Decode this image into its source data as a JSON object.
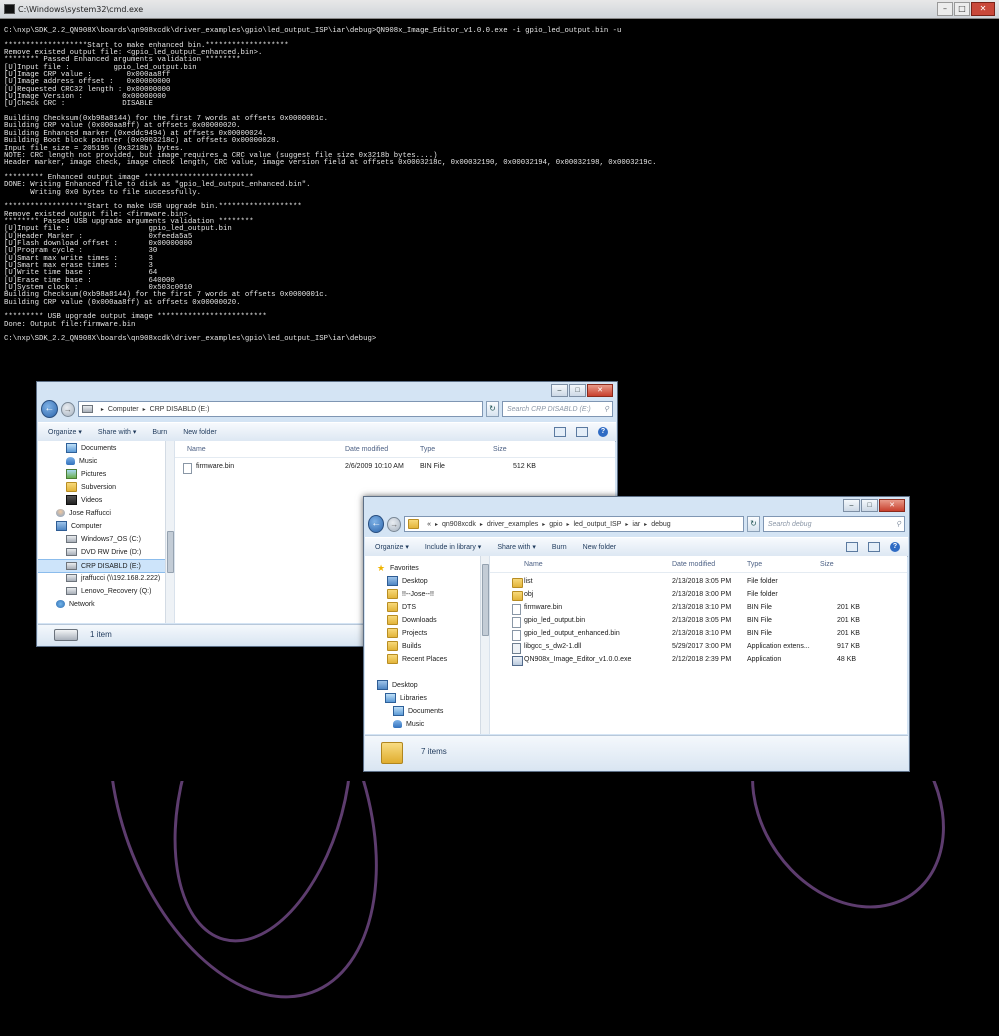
{
  "cmd": {
    "title": "C:\\Windows\\system32\\cmd.exe",
    "lines": [
      "C:\\nxp\\SDK_2.2_QN908X\\boards\\qn908xcdk\\driver_examples\\gpio\\led_output_ISP\\iar\\debug>QN908x_Image_Editor_v1.0.0.exe -i gpio_led_output.bin -u",
      "",
      "*******************Start to make enhanced bin.*******************",
      "Remove existed output file: <gpio_led_output_enhanced.bin>.",
      "******** Passed Enhanced arguments validation ********",
      "[U]Input file :          gpio_led_output.bin",
      "[U]Image CRP value :        0x000aa8ff",
      "[U]Image address offset :   0x00000000",
      "[U]Requested CRC32 length : 0x00000000",
      "[U]Image Version :         0x00000000",
      "[U]Check CRC :             DISABLE",
      "",
      "Building Checksum(0xb98a8144) for the first 7 words at offsets 0x0000001c.",
      "Building CRP value (0x000aa8ff) at offsets 0x00000020.",
      "Building Enhanced marker (0xeddc9494) at offsets 0x00000024.",
      "Building Boot block pointer (0x0003218c) at offsets 0x00000028.",
      "Input file size = 205195 (0x3218b) bytes.",
      "NOTE: CRC length not provided, but image requires a CRC value (suggest file size 0x3218b bytes....)",
      "Header marker, image check, image check length, CRC value, image version field at offsets 0x0003218c, 0x00032190, 0x00032194, 0x00032198, 0x0003219c.",
      "",
      "********* Enhanced output image *************************",
      "DONE: Writing Enhanced file to disk as \"gpio_led_output_enhanced.bin\".",
      "      Writing 0x0 bytes to file successfully.",
      "",
      "*******************Start to make USB upgrade bin.*******************",
      "Remove existed output file: <firmware.bin>.",
      "******** Passed USB upgrade arguments validation ********",
      "[U]Input file :                  gpio_led_output.bin",
      "[U]Header Marker :               0xfeeda5a5",
      "[U]Flash download offset :       0x00000000",
      "[U]Program cycle :               30",
      "[U]Smart max write times :       3",
      "[U]Smart max erase times :       3",
      "[U]Write time base :             64",
      "[U]Erase time base :             640000",
      "[U]System clock :                0x503c0010",
      "Building Checksum(0xb98a8144) for the first 7 words at offsets 0x0000001c.",
      "Building CRP value (0x000aa8ff) at offsets 0x00000020.",
      "",
      "********* USB upgrade output image *************************",
      "Done: Output file:firmware.bin",
      "",
      "C:\\nxp\\SDK_2.2_QN908X\\boards\\qn908xcdk\\driver_examples\\gpio\\led_output_ISP\\iar\\debug>"
    ]
  },
  "window1": {
    "path": [
      "Computer",
      "CRP DISABLD (E:)"
    ],
    "search_placeholder": "Search CRP DISABLD (E:)",
    "toolbar": {
      "organize": "Organize",
      "share": "Share with",
      "burn": "Burn",
      "new_folder": "New folder"
    },
    "columns": {
      "name": "Name",
      "date": "Date modified",
      "type": "Type",
      "size": "Size"
    },
    "nav": [
      {
        "label": "Documents",
        "icon": "documents-icon"
      },
      {
        "label": "Music",
        "icon": "music-icon"
      },
      {
        "label": "Pictures",
        "icon": "pictures-icon"
      },
      {
        "label": "Subversion",
        "icon": "folder-icon"
      },
      {
        "label": "Videos",
        "icon": "videos-icon"
      },
      {
        "label": "Jose Raffucci",
        "icon": "user-icon"
      },
      {
        "label": "Computer",
        "icon": "computer-icon"
      },
      {
        "label": "Windows7_OS (C:)",
        "icon": "drive-icon"
      },
      {
        "label": "DVD RW Drive (D:)",
        "icon": "dvd-drive-icon"
      },
      {
        "label": "CRP DISABLD (E:)",
        "icon": "drive-icon",
        "selected": true
      },
      {
        "label": "jraffucci (\\\\192.168.2.222)",
        "icon": "network-drive-icon"
      },
      {
        "label": "Lenovo_Recovery (Q:)",
        "icon": "drive-icon"
      },
      {
        "label": "Network",
        "icon": "network-icon"
      }
    ],
    "files": [
      {
        "name": "firmware.bin",
        "date": "2/6/2009 10:10 AM",
        "type": "BIN File",
        "size": "512 KB",
        "icon": "file-icon"
      }
    ],
    "status": "1 item"
  },
  "window2": {
    "path": [
      "qn908xcdk",
      "driver_examples",
      "gpio",
      "led_output_ISP",
      "iar",
      "debug"
    ],
    "path_prefix": "«",
    "search_placeholder": "Search debug",
    "toolbar": {
      "organize": "Organize",
      "include": "Include in library",
      "share": "Share with",
      "burn": "Burn",
      "new_folder": "New folder"
    },
    "columns": {
      "name": "Name",
      "date": "Date modified",
      "type": "Type",
      "size": "Size"
    },
    "nav": [
      {
        "label": "Favorites",
        "icon": "star-icon"
      },
      {
        "label": "Desktop",
        "icon": "desktop-icon"
      },
      {
        "label": "!!--Jose--!!",
        "icon": "folder-icon"
      },
      {
        "label": "DTS",
        "icon": "folder-icon"
      },
      {
        "label": "Downloads",
        "icon": "downloads-icon"
      },
      {
        "label": "Projects",
        "icon": "folder-icon"
      },
      {
        "label": "Builds",
        "icon": "folder-icon"
      },
      {
        "label": "Recent Places",
        "icon": "recent-places-icon"
      },
      {
        "label": "",
        "icon": ""
      },
      {
        "label": "Desktop",
        "icon": "desktop-icon"
      },
      {
        "label": "Libraries",
        "icon": "libraries-icon"
      },
      {
        "label": "Documents",
        "icon": "documents-icon"
      },
      {
        "label": "Music",
        "icon": "music-icon"
      }
    ],
    "files": [
      {
        "name": "list",
        "date": "2/13/2018 3:05 PM",
        "type": "File folder",
        "size": "",
        "icon": "folder-icon"
      },
      {
        "name": "obj",
        "date": "2/13/2018 3:00 PM",
        "type": "File folder",
        "size": "",
        "icon": "folder-icon"
      },
      {
        "name": "firmware.bin",
        "date": "2/13/2018 3:10 PM",
        "type": "BIN File",
        "size": "201 KB",
        "icon": "file-icon"
      },
      {
        "name": "gpio_led_output.bin",
        "date": "2/13/2018 3:05 PM",
        "type": "BIN File",
        "size": "201 KB",
        "icon": "file-icon"
      },
      {
        "name": "gpio_led_output_enhanced.bin",
        "date": "2/13/2018 3:10 PM",
        "type": "BIN File",
        "size": "201 KB",
        "icon": "file-icon"
      },
      {
        "name": "libgcc_s_dw2-1.dll",
        "date": "5/29/2017 3:00 PM",
        "type": "Application extens...",
        "size": "917 KB",
        "icon": "dll-icon"
      },
      {
        "name": "QN908x_Image_Editor_v1.0.0.exe",
        "date": "2/12/2018 2:39 PM",
        "type": "Application",
        "size": "48 KB",
        "icon": "exe-icon"
      }
    ],
    "status": "7 items"
  }
}
